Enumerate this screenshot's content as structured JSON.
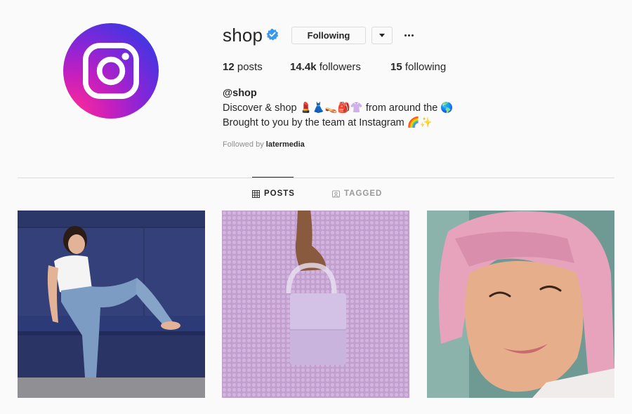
{
  "profile": {
    "username": "shop",
    "follow_button_label": "Following",
    "stats": {
      "posts_count": "12",
      "posts_label": " posts",
      "followers_count": "14.4k",
      "followers_label": " followers",
      "following_count": "15",
      "following_label": " following"
    },
    "bio": {
      "handle": "@shop",
      "line1": "Discover & shop 💄👗👡🎒👚 from around the 🌎",
      "line2": "Brought to you by the team at Instagram 🌈✨"
    },
    "followed_by_prefix": "Followed by ",
    "followed_by_user": "latermedia"
  },
  "tabs": [
    {
      "label": "POSTS",
      "active": true,
      "icon": "grid-icon"
    },
    {
      "label": "TAGGED",
      "active": false,
      "icon": "tag-icon"
    }
  ],
  "colors": {
    "verified": "#3897f0",
    "text": "#262626",
    "muted": "#8e8e8e",
    "border": "#dbdbdb"
  }
}
